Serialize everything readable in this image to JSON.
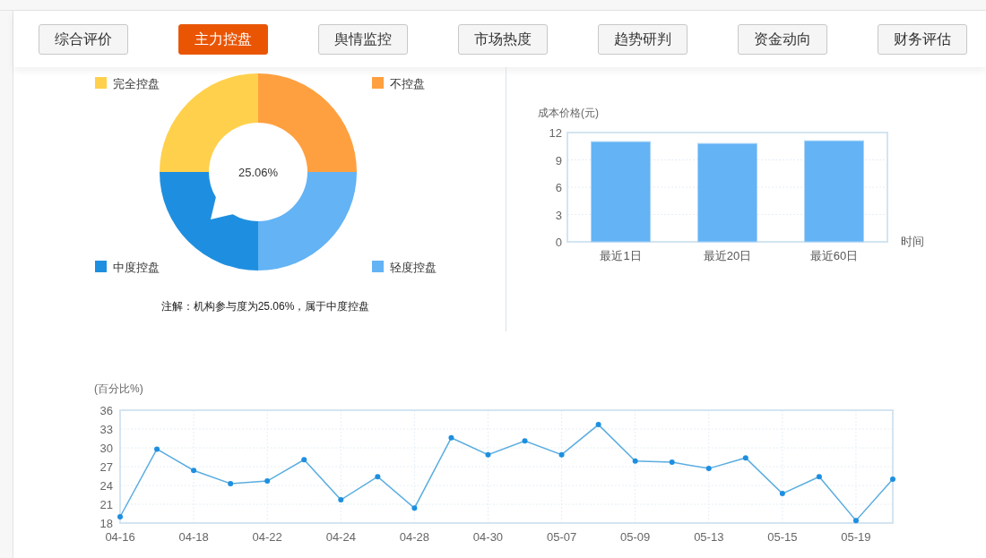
{
  "tabs": [
    {
      "label": "综合评价",
      "selected": false
    },
    {
      "label": "主力控盘",
      "selected": true
    },
    {
      "label": "舆情监控",
      "selected": false
    },
    {
      "label": "市场热度",
      "selected": false
    },
    {
      "label": "趋势研判",
      "selected": false
    },
    {
      "label": "资金动向",
      "selected": false
    },
    {
      "label": "财务评估",
      "selected": false
    }
  ],
  "control_chart": {
    "legend": [
      {
        "label": "完全控盘",
        "color": "#ffd04b",
        "selected": false
      },
      {
        "label": "不控盘",
        "color": "#ffa040",
        "selected": false
      },
      {
        "label": "中度控盘",
        "color": "#1e8fe0",
        "selected": true
      },
      {
        "label": "轻度控盘",
        "color": "#63b3f5",
        "selected": false
      }
    ],
    "center_label": "25.06%",
    "note": "注解：机构参与度为25.06%，属于中度控盘"
  },
  "cost_chart": {
    "chart_data": {
      "type": "bar",
      "ylabel": "成本价格(元)",
      "xlabel": "时间",
      "categories": [
        "最近1日",
        "最近20日",
        "最近60日"
      ],
      "ylim": [
        0,
        12
      ],
      "yticks": [
        0,
        3,
        6,
        9,
        12
      ],
      "grid": true,
      "series": [
        {
          "color": "#63b3f5",
          "values": [
            11.0,
            10.8,
            11.1
          ]
        }
      ]
    }
  },
  "ratio_chart": {
    "chart_data": {
      "type": "line",
      "ylabel": "(百分比%)",
      "categories": [
        "04-16",
        null,
        "04-18",
        null,
        "04-22",
        null,
        "04-24",
        null,
        "04-28",
        null,
        "04-30",
        null,
        "05-07",
        null,
        "05-09",
        null,
        "05-13",
        null,
        "05-15",
        null,
        "05-19",
        null
      ],
      "ylim": [
        18,
        36
      ],
      "yticks": [
        18,
        21,
        24,
        27,
        30,
        33,
        36
      ],
      "grid": true,
      "series": [
        {
          "color": "#5aade0",
          "marker": true,
          "values": [
            19.0,
            29.8,
            26.4,
            24.3,
            24.7,
            28.1,
            21.7,
            25.4,
            20.4,
            31.6,
            28.9,
            31.1,
            28.9,
            33.7,
            27.9,
            27.7,
            26.7,
            28.4,
            22.7,
            25.4,
            18.4,
            25.0
          ]
        }
      ]
    }
  }
}
